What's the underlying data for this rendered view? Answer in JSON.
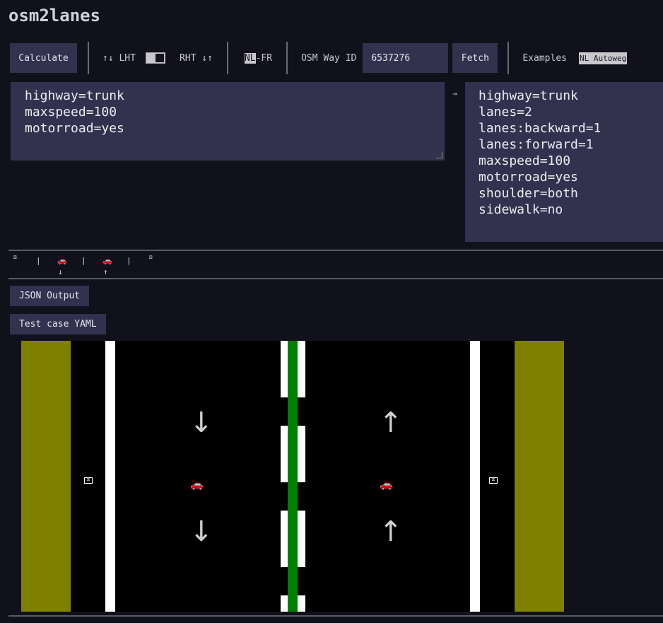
{
  "app": {
    "title": "osm2lanes"
  },
  "toolbar": {
    "calculate_label": "Calculate",
    "lht_label": "↑↓ LHT",
    "rht_label": "RHT ↓↑",
    "locale_nl": "NL",
    "locale_rest": "-FR",
    "osm_way_id_label": "OSM Way ID",
    "osm_way_id_value": "6537276",
    "fetch_label": "Fetch",
    "examples_label": "Examples",
    "examples_selected": "NL Autoweg"
  },
  "input_tags": "highway=trunk\nmaxspeed=100\nmotorroad=yes",
  "output_arrow": "→",
  "output_tags": [
    "highway=trunk",
    "lanes=2",
    "lanes:backward=1",
    "lanes:forward=1",
    "maxspeed=100",
    "motorroad=yes",
    "shoulder=both",
    "sidewalk=no"
  ],
  "lanes_summary": {
    "separator": "|",
    "shoulder_glyph": "⛝",
    "car_glyph": "🚗",
    "backward_arrow": "↓",
    "forward_arrow": "↑"
  },
  "buttons": {
    "json_output": "JSON Output",
    "test_case_yaml": "Test case YAML"
  },
  "render": {
    "grass_color": "#7f7f00",
    "median_color": "#008000",
    "backward_arrow": "↓",
    "forward_arrow": "↑",
    "car_glyph": "🚗"
  }
}
